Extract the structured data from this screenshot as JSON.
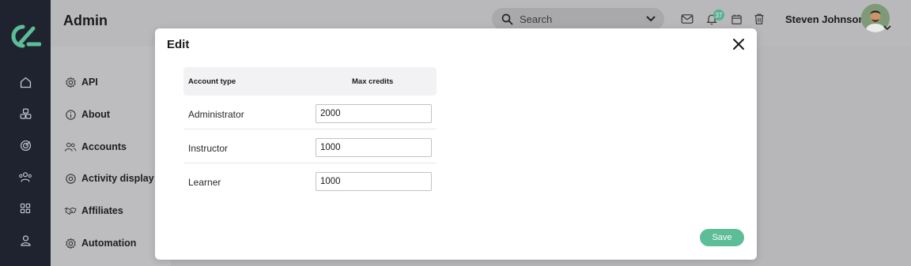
{
  "header": {
    "app_title": "Admin",
    "search_placeholder": "Search",
    "notification_count": "37",
    "user_name": "Steven Johnson"
  },
  "rail": {
    "icons": [
      "home-icon",
      "cubes-icon",
      "target-icon",
      "users-icon",
      "grid-icon",
      "user-icon"
    ]
  },
  "settings_menu": {
    "items": [
      {
        "label": "API",
        "icon": "gear-icon"
      },
      {
        "label": "About",
        "icon": "info-icon"
      },
      {
        "label": "Accounts",
        "icon": "users-icon"
      },
      {
        "label": "Activity display",
        "icon": "target-icon"
      },
      {
        "label": "Affiliates",
        "icon": "handshake-icon"
      },
      {
        "label": "Automation",
        "icon": "gear-icon"
      }
    ]
  },
  "modal": {
    "title": "Edit",
    "table": {
      "headers": [
        "Account type",
        "Max credits"
      ],
      "rows": [
        {
          "account_type": "Administrator",
          "max_credits": "2000"
        },
        {
          "account_type": "Instructor",
          "max_credits": "1000"
        },
        {
          "account_type": "Learner",
          "max_credits": "1000"
        }
      ]
    },
    "save_label": "Save"
  },
  "colors": {
    "accent": "#5cbd96",
    "rail": "#1f2330",
    "overlay": "#b9b9bb"
  }
}
